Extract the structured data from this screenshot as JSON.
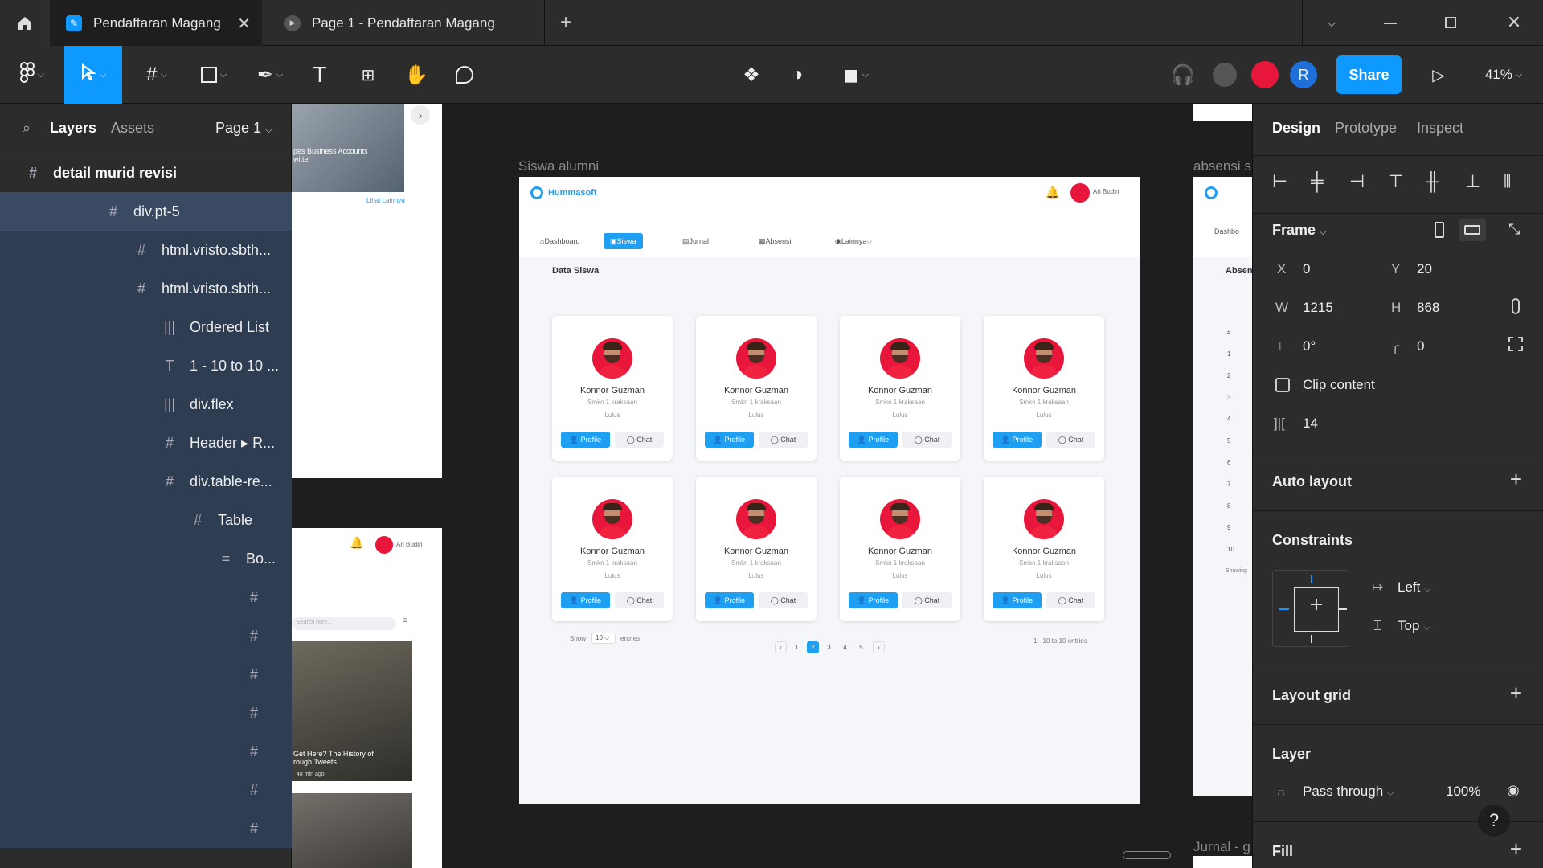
{
  "tabs": {
    "active_title": "Pendaftaran Magang",
    "second_title": "Page 1 - Pendaftaran Magang"
  },
  "toolbar": {
    "share_label": "Share",
    "zoom": "41%",
    "user_initial": "R"
  },
  "left_panel": {
    "tab_layers": "Layers",
    "tab_assets": "Assets",
    "page": "Page 1",
    "frame_title": "detail murid revisi",
    "layers": [
      {
        "label": "div.pt-5",
        "icon": "#"
      },
      {
        "label": "html.vristo.sbth...",
        "icon": "#"
      },
      {
        "label": "html.vristo.sbth...",
        "icon": "#"
      },
      {
        "label": "Ordered List",
        "icon": "|||"
      },
      {
        "label": "1 - 10 to 10 ...",
        "icon": "T"
      },
      {
        "label": "div.flex",
        "icon": "|||"
      },
      {
        "label": "Header ▸ R...",
        "icon": "#"
      },
      {
        "label": "div.table-re...",
        "icon": "#"
      },
      {
        "label": "Table",
        "icon": "#"
      },
      {
        "label": "Bo...",
        "icon": "="
      },
      {
        "label": "",
        "icon": "#"
      },
      {
        "label": "",
        "icon": "#"
      },
      {
        "label": "",
        "icon": "#"
      },
      {
        "label": "",
        "icon": "#"
      },
      {
        "label": "",
        "icon": "#"
      },
      {
        "label": "",
        "icon": "#"
      },
      {
        "label": "",
        "icon": "#"
      }
    ]
  },
  "right_panel": {
    "tab_design": "Design",
    "tab_prototype": "Prototype",
    "tab_inspect": "Inspect",
    "frame_label": "Frame",
    "x_label": "X",
    "x": "0",
    "y_label": "Y",
    "y": "20",
    "w_label": "W",
    "w": "1215",
    "h_label": "H",
    "h": "868",
    "rotation": "0°",
    "radius": "0",
    "clip_content": "Clip content",
    "spacing": "14",
    "auto_layout": "Auto layout",
    "constraints": "Constraints",
    "constraint_h": "Left",
    "constraint_v": "Top",
    "layout_grid": "Layout grid",
    "layer": "Layer",
    "blend": "Pass through",
    "opacity": "100%",
    "fill": "Fill"
  },
  "canvas": {
    "frame_siswa_label": "Siswa alumni",
    "frame_absensi_label": "absensi s",
    "frame_jurnal_label": "Jurnal - g",
    "brand": "Hummasoft",
    "user_name": "Ari Budin",
    "nav": [
      "Dashboard",
      "Siswa",
      "Jurnal",
      "Absensi",
      "Lainnya"
    ],
    "section_title": "Data Siswa",
    "student": {
      "name": "Konnor Guzman",
      "school": "Smkn 1 kraksaan",
      "status": "Lulus",
      "profile_btn": "Profile",
      "chat_btn": "Chat"
    },
    "show_label": "Show",
    "show_value": "10",
    "entries_label": "entries",
    "pages": [
      "1",
      "2",
      "3",
      "4",
      "5"
    ],
    "active_page": "2",
    "range_text": "1 - 10 to 10 entries",
    "left_frame_caption": "pes Business Accounts\nwitter",
    "left_frame_link": "Lihat Lainnya",
    "left_frame2_search": "Search here...",
    "left_frame2_caption": "Get Here? The History of\nrough Tweets",
    "left_frame2_time": "48 min ago",
    "absensi_title": "Absen",
    "absensi_nav": "Dashbo",
    "absensi_rows": [
      "#",
      "1",
      "2",
      "3",
      "4",
      "5",
      "6",
      "7",
      "8",
      "9",
      "10"
    ],
    "absensi_showing": "Showing"
  },
  "colors": {
    "accent": "#0d99ff",
    "brand_blue": "#1e9ff2",
    "avatar_red": "#e8163b",
    "layer_highlight": "#2f3d52"
  }
}
